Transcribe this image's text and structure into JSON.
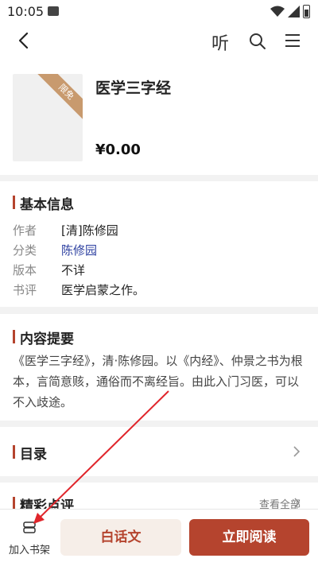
{
  "status": {
    "time": "10:05"
  },
  "appbar": {
    "listen_label": "听",
    "icons": [
      "back-arrow-icon",
      "search-icon",
      "menu-icon"
    ]
  },
  "book": {
    "title": "医学三字经",
    "price": "¥0.00",
    "ribbon": "限免"
  },
  "basic_info": {
    "title": "基本信息",
    "rows": [
      {
        "key": "作者",
        "value": "[清]陈修园"
      },
      {
        "key": "分类",
        "value": "陈修园"
      },
      {
        "key": "版本",
        "value": "不详"
      },
      {
        "key": "书评",
        "value": "医学启蒙之作。"
      }
    ]
  },
  "summary": {
    "title": "内容提要",
    "text": "《医学三字经》，清·陈修园。以《内经》、仲景之书为根本，言简意赅，通俗而不离经旨。由此入门习医，可以不入歧途。"
  },
  "toc": {
    "title": "目录"
  },
  "reviews": {
    "title": "精彩点评",
    "see_all": "查看全部"
  },
  "bottom": {
    "shelf_label": "加入书架",
    "vernacular_label": "白话文",
    "read_label": "立即阅读"
  },
  "colors": {
    "accent": "#b5442e",
    "link": "#2c3fa0",
    "ribbon": "#c89a6e"
  }
}
